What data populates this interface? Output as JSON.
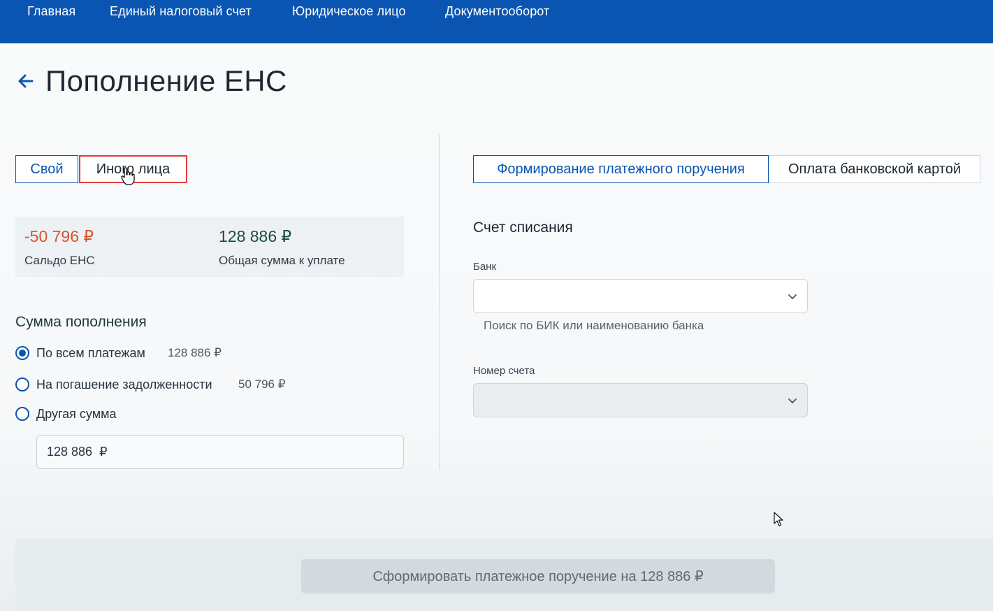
{
  "nav": {
    "items": [
      "Главная",
      "Единый налоговый счет",
      "Юридическое лицо",
      "Документооборот"
    ]
  },
  "page": {
    "title": "Пополнение ЕНС",
    "back_icon": "arrow-left-icon"
  },
  "payer_tabs": {
    "self": "Свой",
    "other": "Иного лица",
    "selected": "self",
    "highlighted": "other"
  },
  "balance": {
    "saldo_value": "-50 796 ₽",
    "saldo_label": "Сальдо ЕНС",
    "total_value": "128 886 ₽",
    "total_label": "Общая сумма к уплате"
  },
  "amount": {
    "title": "Сумма пополнения",
    "options": [
      {
        "label": "По всем платежам",
        "amount": "128 886 ₽",
        "checked": true
      },
      {
        "label": "На погашение задолженности",
        "amount": "50 796 ₽",
        "checked": false
      },
      {
        "label": "Другая сумма",
        "amount": "",
        "checked": false
      }
    ],
    "input_value": "128 886  ₽"
  },
  "payment_tabs": {
    "order": "Формирование платежного поручения",
    "card": "Оплата банковской картой",
    "selected": "order"
  },
  "account": {
    "title": "Счет списания",
    "bank_label": "Банк",
    "bank_hint": "Поиск по БИК или наименованию банка",
    "number_label": "Номер счета"
  },
  "submit": {
    "label": "Сформировать платежное поручение на 128 886 ₽"
  },
  "colors": {
    "nav_bg": "#0a55b2",
    "accent": "#0a55b2",
    "negative": "#d9532a",
    "total": "#1a4d3a",
    "highlight": "#e53c3c"
  }
}
